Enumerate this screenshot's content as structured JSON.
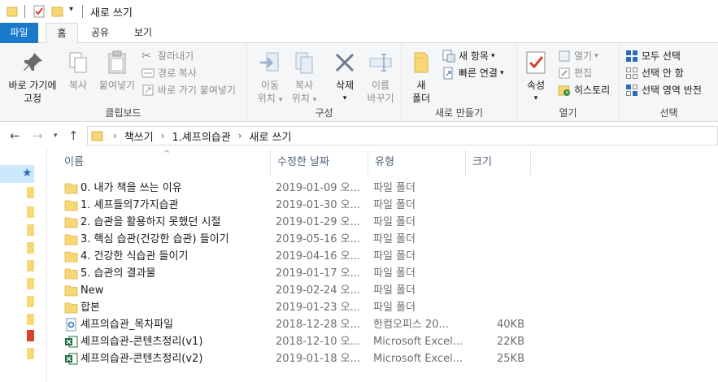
{
  "window": {
    "title": "새로 쓰기"
  },
  "tabs": [
    {
      "label": "파일"
    },
    {
      "label": "홈"
    },
    {
      "label": "공유"
    },
    {
      "label": "보기"
    }
  ],
  "ribbon": {
    "clipboard": {
      "label": "클립보드",
      "pin": "바로 가기에\n고정",
      "copy": "복사",
      "paste": "붙여넣기",
      "cut": "잘라내기",
      "copy_path": "경로 복사",
      "paste_shortcut": "바로 가기 붙여넣기"
    },
    "organize": {
      "label": "구성",
      "move_to": "이동\n위치",
      "copy_to": "복사\n위치",
      "delete": "삭제",
      "rename": "이름\n바꾸기"
    },
    "new": {
      "label": "새로 만들기",
      "new_folder": "새\n폴더",
      "new_item": "새 항목",
      "easy_access": "빠른 연결"
    },
    "open": {
      "label": "열기",
      "properties": "속성",
      "open": "열기",
      "edit": "편집",
      "history": "히스토리"
    },
    "select": {
      "label": "선택",
      "select_all": "모두 선택",
      "select_none": "선택 안 함",
      "invert": "선택 영역 반전"
    }
  },
  "address": {
    "crumbs": [
      "책쓰기",
      "1.셰프의습관",
      "새로 쓰기"
    ]
  },
  "columns": {
    "name": "이름",
    "date": "수정한 날짜",
    "type": "유형",
    "size": "크기"
  },
  "files": [
    {
      "name": "0. 내가 책을 쓰는 이유",
      "date": "2019-01-09 오...",
      "type": "파일 폴더",
      "size": "",
      "kind": "folder"
    },
    {
      "name": "1. 셰프들의7가지습관",
      "date": "2019-01-30 오...",
      "type": "파일 폴더",
      "size": "",
      "kind": "folder"
    },
    {
      "name": "2. 습관을 활용하지 못했던 시절",
      "date": "2019-01-29 오...",
      "type": "파일 폴더",
      "size": "",
      "kind": "folder"
    },
    {
      "name": "3. 핵심 습관(건강한 습관) 들이기",
      "date": "2019-05-16 오...",
      "type": "파일 폴더",
      "size": "",
      "kind": "folder"
    },
    {
      "name": "4. 건강한 식습관 들이기",
      "date": "2019-04-16 오...",
      "type": "파일 폴더",
      "size": "",
      "kind": "folder"
    },
    {
      "name": "5. 습관의 결과물",
      "date": "2019-01-17 오...",
      "type": "파일 폴더",
      "size": "",
      "kind": "folder"
    },
    {
      "name": "New",
      "date": "2019-02-24 오...",
      "type": "파일 폴더",
      "size": "",
      "kind": "folder"
    },
    {
      "name": "합본",
      "date": "2019-01-23 오...",
      "type": "파일 폴더",
      "size": "",
      "kind": "folder"
    },
    {
      "name": "셰프의습관_목차파일",
      "date": "2018-12-28 오...",
      "type": "한컴오피스 20...",
      "size": "40KB",
      "kind": "hwp"
    },
    {
      "name": "셰프의습관-콘텐츠정리(v1)",
      "date": "2018-12-10 오...",
      "type": "Microsoft Excel...",
      "size": "22KB",
      "kind": "excel"
    },
    {
      "name": "셰프의습관-콘텐츠정리(v2)",
      "date": "2019-01-18 오...",
      "type": "Microsoft Excel...",
      "size": "25KB",
      "kind": "excel"
    }
  ],
  "colors": {
    "file_tab": "#1979ca",
    "folder": "#f8d775",
    "excel": "#1d6f42",
    "selection": "#cce8ff"
  }
}
